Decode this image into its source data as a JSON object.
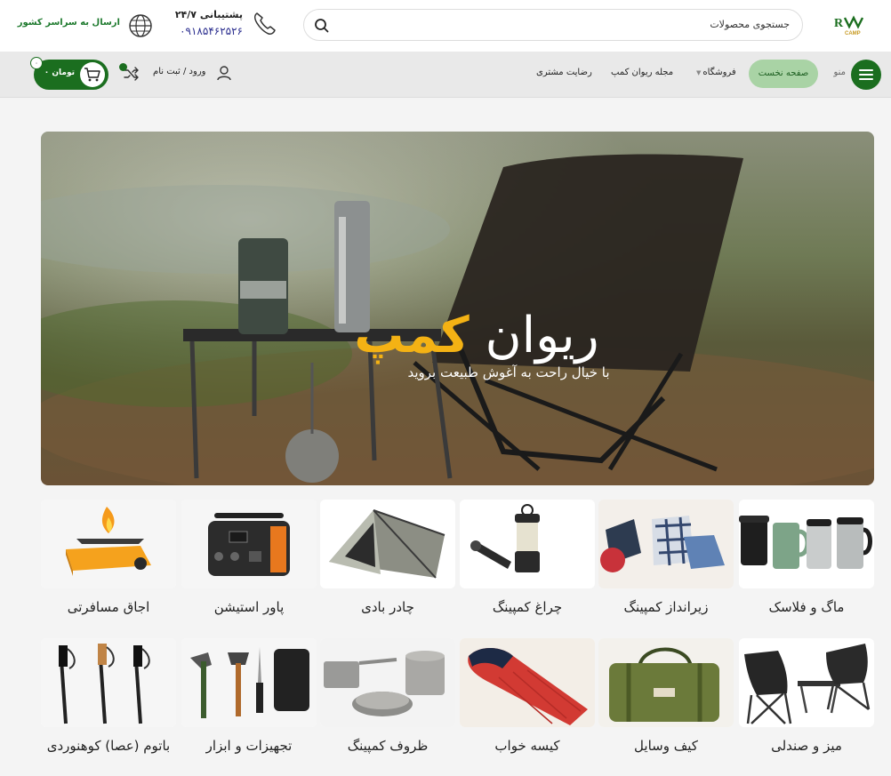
{
  "header": {
    "logo_text": "RiVAN CAMP",
    "search_placeholder": "جستجوی محصولات",
    "support_label": "پشتیبانی ۲۴/۷",
    "support_phone": "۰۹۱۸۵۴۶۲۵۲۶",
    "shipping_label": "ارسال به سراسر کشور"
  },
  "nav": {
    "menu_label": "منو",
    "items": [
      {
        "label": "صفحه نخست",
        "active": true
      },
      {
        "label": "فروشگاه",
        "has_dropdown": true
      },
      {
        "label": "مجله ریوان کمپ"
      },
      {
        "label": "رضایت مشتری"
      }
    ],
    "login_label": "ورود / ثبت نام",
    "cart_amount": "۰ تومان",
    "cart_count": "۰",
    "accent_color": "#1b6e1f"
  },
  "hero": {
    "title_main": "ریوان",
    "title_accent": "کمپ",
    "subtitle": "با خیال راحت به آغوش طبیعت بروید"
  },
  "categories": [
    {
      "label": "ماگ و فلاسک",
      "icon": "mugs-icon"
    },
    {
      "label": "زیرانداز کمپینگ",
      "icon": "blankets-icon"
    },
    {
      "label": "چراغ کمپینگ",
      "icon": "lantern-icon"
    },
    {
      "label": "چادر بادی",
      "icon": "tent-icon"
    },
    {
      "label": "پاور استیشن",
      "icon": "power-station-icon"
    },
    {
      "label": "اجاق مسافرتی",
      "icon": "stove-icon"
    },
    {
      "label": "میز و صندلی",
      "icon": "chairs-icon"
    },
    {
      "label": "کیف وسایل",
      "icon": "bag-icon"
    },
    {
      "label": "کیسه خواب",
      "icon": "sleeping-bag-icon"
    },
    {
      "label": "ظروف کمپینگ",
      "icon": "cookware-icon"
    },
    {
      "label": "تجهیزات و ابزار",
      "icon": "tools-icon"
    },
    {
      "label": "باتوم (عصا) کوهنوردی",
      "icon": "trekking-poles-icon"
    }
  ]
}
